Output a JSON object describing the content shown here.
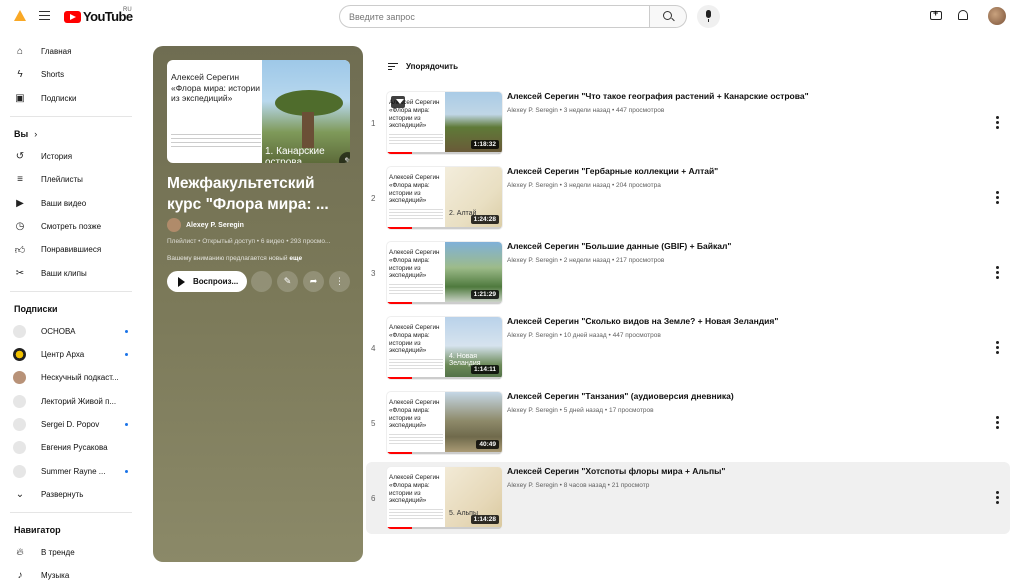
{
  "header": {
    "logo_text": "YouTube",
    "logo_country": "RU",
    "search_placeholder": "Введите запрос"
  },
  "sidebar": {
    "main": [
      {
        "label": "Главная",
        "icon": "home-icon"
      },
      {
        "label": "Shorts",
        "icon": "shorts-icon"
      },
      {
        "label": "Подписки",
        "icon": "subscriptions-icon"
      }
    ],
    "you_header": "Вы",
    "you": [
      {
        "label": "История",
        "icon": "history-icon"
      },
      {
        "label": "Плейлисты",
        "icon": "playlists-icon"
      },
      {
        "label": "Ваши видео",
        "icon": "your-videos-icon"
      },
      {
        "label": "Смотреть позже",
        "icon": "watch-later-icon"
      },
      {
        "label": "Понравившиеся",
        "icon": "liked-icon"
      },
      {
        "label": "Ваши клипы",
        "icon": "clips-icon"
      }
    ],
    "subs_header": "Подписки",
    "subs": [
      {
        "label": "ОСНОВА",
        "dot": true
      },
      {
        "label": "Центр Арха",
        "dot": true
      },
      {
        "label": "Нескучный подкаст...",
        "dot": false
      },
      {
        "label": "Лекторий Живой п...",
        "dot": false
      },
      {
        "label": "Sergei D. Popov",
        "dot": true
      },
      {
        "label": "Евгения Русакова",
        "dot": false
      },
      {
        "label": "Summer Rayne ...",
        "dot": true
      }
    ],
    "expand_label": "Развернуть",
    "nav_header": "Навигатор",
    "nav": [
      {
        "label": "В тренде",
        "icon": "trending-icon"
      },
      {
        "label": "Музыка",
        "icon": "music-icon"
      }
    ]
  },
  "playlist": {
    "cover_text": "Алексей Серегин «Флора мира: истории из экспедиций»",
    "cover_caption": "1. Канарские острова",
    "title": "Межфакультетский курс \"Флора мира: ...",
    "owner": "Alexey P. Seregin",
    "meta": "Плейлист • Открытый доступ • 6 видео • 293 просмо...",
    "desc_prefix": "Вашему вниманию предлагается новый",
    "desc_more": "еще",
    "play_label": "Воспроиз..."
  },
  "sort_label": "Упорядочить",
  "videos": [
    {
      "index": "1",
      "title": "Алексей Серегин \"Что такое география растений + Канарские острова\"",
      "meta": "Alexey P. Seregin • 3 недели назад • 447 просмотров",
      "duration": "1:18:32",
      "thumb_caption": "",
      "progress": 0.0,
      "watch_later": true
    },
    {
      "index": "2",
      "title": "Алексей Серегин \"Гербарные коллекции + Алтай\"",
      "meta": "Alexey P. Seregin • 3 недели назад • 204 просмотра",
      "duration": "1:24:28",
      "thumb_caption": "2. Алтай",
      "progress": 0.0,
      "watch_later": false
    },
    {
      "index": "3",
      "title": "Алексей Серегин \"Большие данные (GBIF) + Байкал\"",
      "meta": "Alexey P. Seregin • 2 недели назад • 217 просмотров",
      "duration": "1:21:29",
      "thumb_caption": "",
      "progress": 0.0,
      "watch_later": false
    },
    {
      "index": "4",
      "title": "Алексей Серегин \"Сколько видов на Земле? + Новая Зеландия\"",
      "meta": "Alexey P. Seregin • 10 дней назад • 447 просмотров",
      "duration": "1:14:11",
      "thumb_caption": "4. Новая Зеландия",
      "progress": 0.0,
      "watch_later": false
    },
    {
      "index": "5",
      "title": "Алексей Серегин \"Танзания\" (аудиоверсия дневника)",
      "meta": "Alexey P. Seregin • 5 дней назад • 17 просмотров",
      "duration": "40:49",
      "thumb_caption": "",
      "progress": 0.0,
      "watch_later": false
    },
    {
      "index": "6",
      "title": "Алексей Серегин \"Хотспоты флоры мира + Альпы\"",
      "meta": "Alexey P. Seregin • 8 часов назад • 21 просмотр",
      "duration": "1:14:28",
      "thumb_caption": "5. Альпы",
      "progress": 0.0,
      "watch_later": false
    }
  ],
  "thumb_text": "Алексей Серегин «Флора мира: истории из экспедиций»",
  "colors": {
    "brand_red": "#ff0000",
    "panel_bg": "#76745a",
    "highlight_row": "#f0f0f0",
    "dot_blue": "#1a73e8"
  }
}
